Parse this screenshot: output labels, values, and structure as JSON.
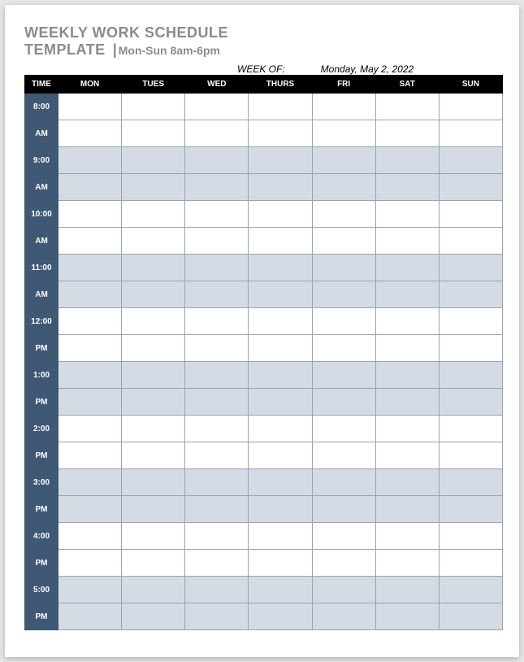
{
  "header": {
    "title_line1": "WEEKLY WORK SCHEDULE",
    "title_bold2": "TEMPLATE",
    "title_separator": "|",
    "title_subtitle": "Mon-Sun 8am-6pm",
    "week_of_label": "WEEK OF:",
    "week_of_value": "Monday, May 2, 2022"
  },
  "columns": {
    "time": "TIME",
    "days": [
      "MON",
      "TUES",
      "WED",
      "THURS",
      "FRI",
      "SAT",
      "SUN"
    ]
  },
  "rows": [
    {
      "label": "8:00",
      "shaded": false
    },
    {
      "label": "AM",
      "shaded": false
    },
    {
      "label": "9:00",
      "shaded": true
    },
    {
      "label": "AM",
      "shaded": true
    },
    {
      "label": "10:00",
      "shaded": false
    },
    {
      "label": "AM",
      "shaded": false
    },
    {
      "label": "11:00",
      "shaded": true
    },
    {
      "label": "AM",
      "shaded": true
    },
    {
      "label": "12:00",
      "shaded": false
    },
    {
      "label": "PM",
      "shaded": false
    },
    {
      "label": "1:00",
      "shaded": true
    },
    {
      "label": "PM",
      "shaded": true
    },
    {
      "label": "2:00",
      "shaded": false
    },
    {
      "label": "PM",
      "shaded": false
    },
    {
      "label": "3:00",
      "shaded": true
    },
    {
      "label": "PM",
      "shaded": true
    },
    {
      "label": "4:00",
      "shaded": false
    },
    {
      "label": "PM",
      "shaded": false
    },
    {
      "label": "5:00",
      "shaded": true
    },
    {
      "label": "PM",
      "shaded": true
    }
  ]
}
